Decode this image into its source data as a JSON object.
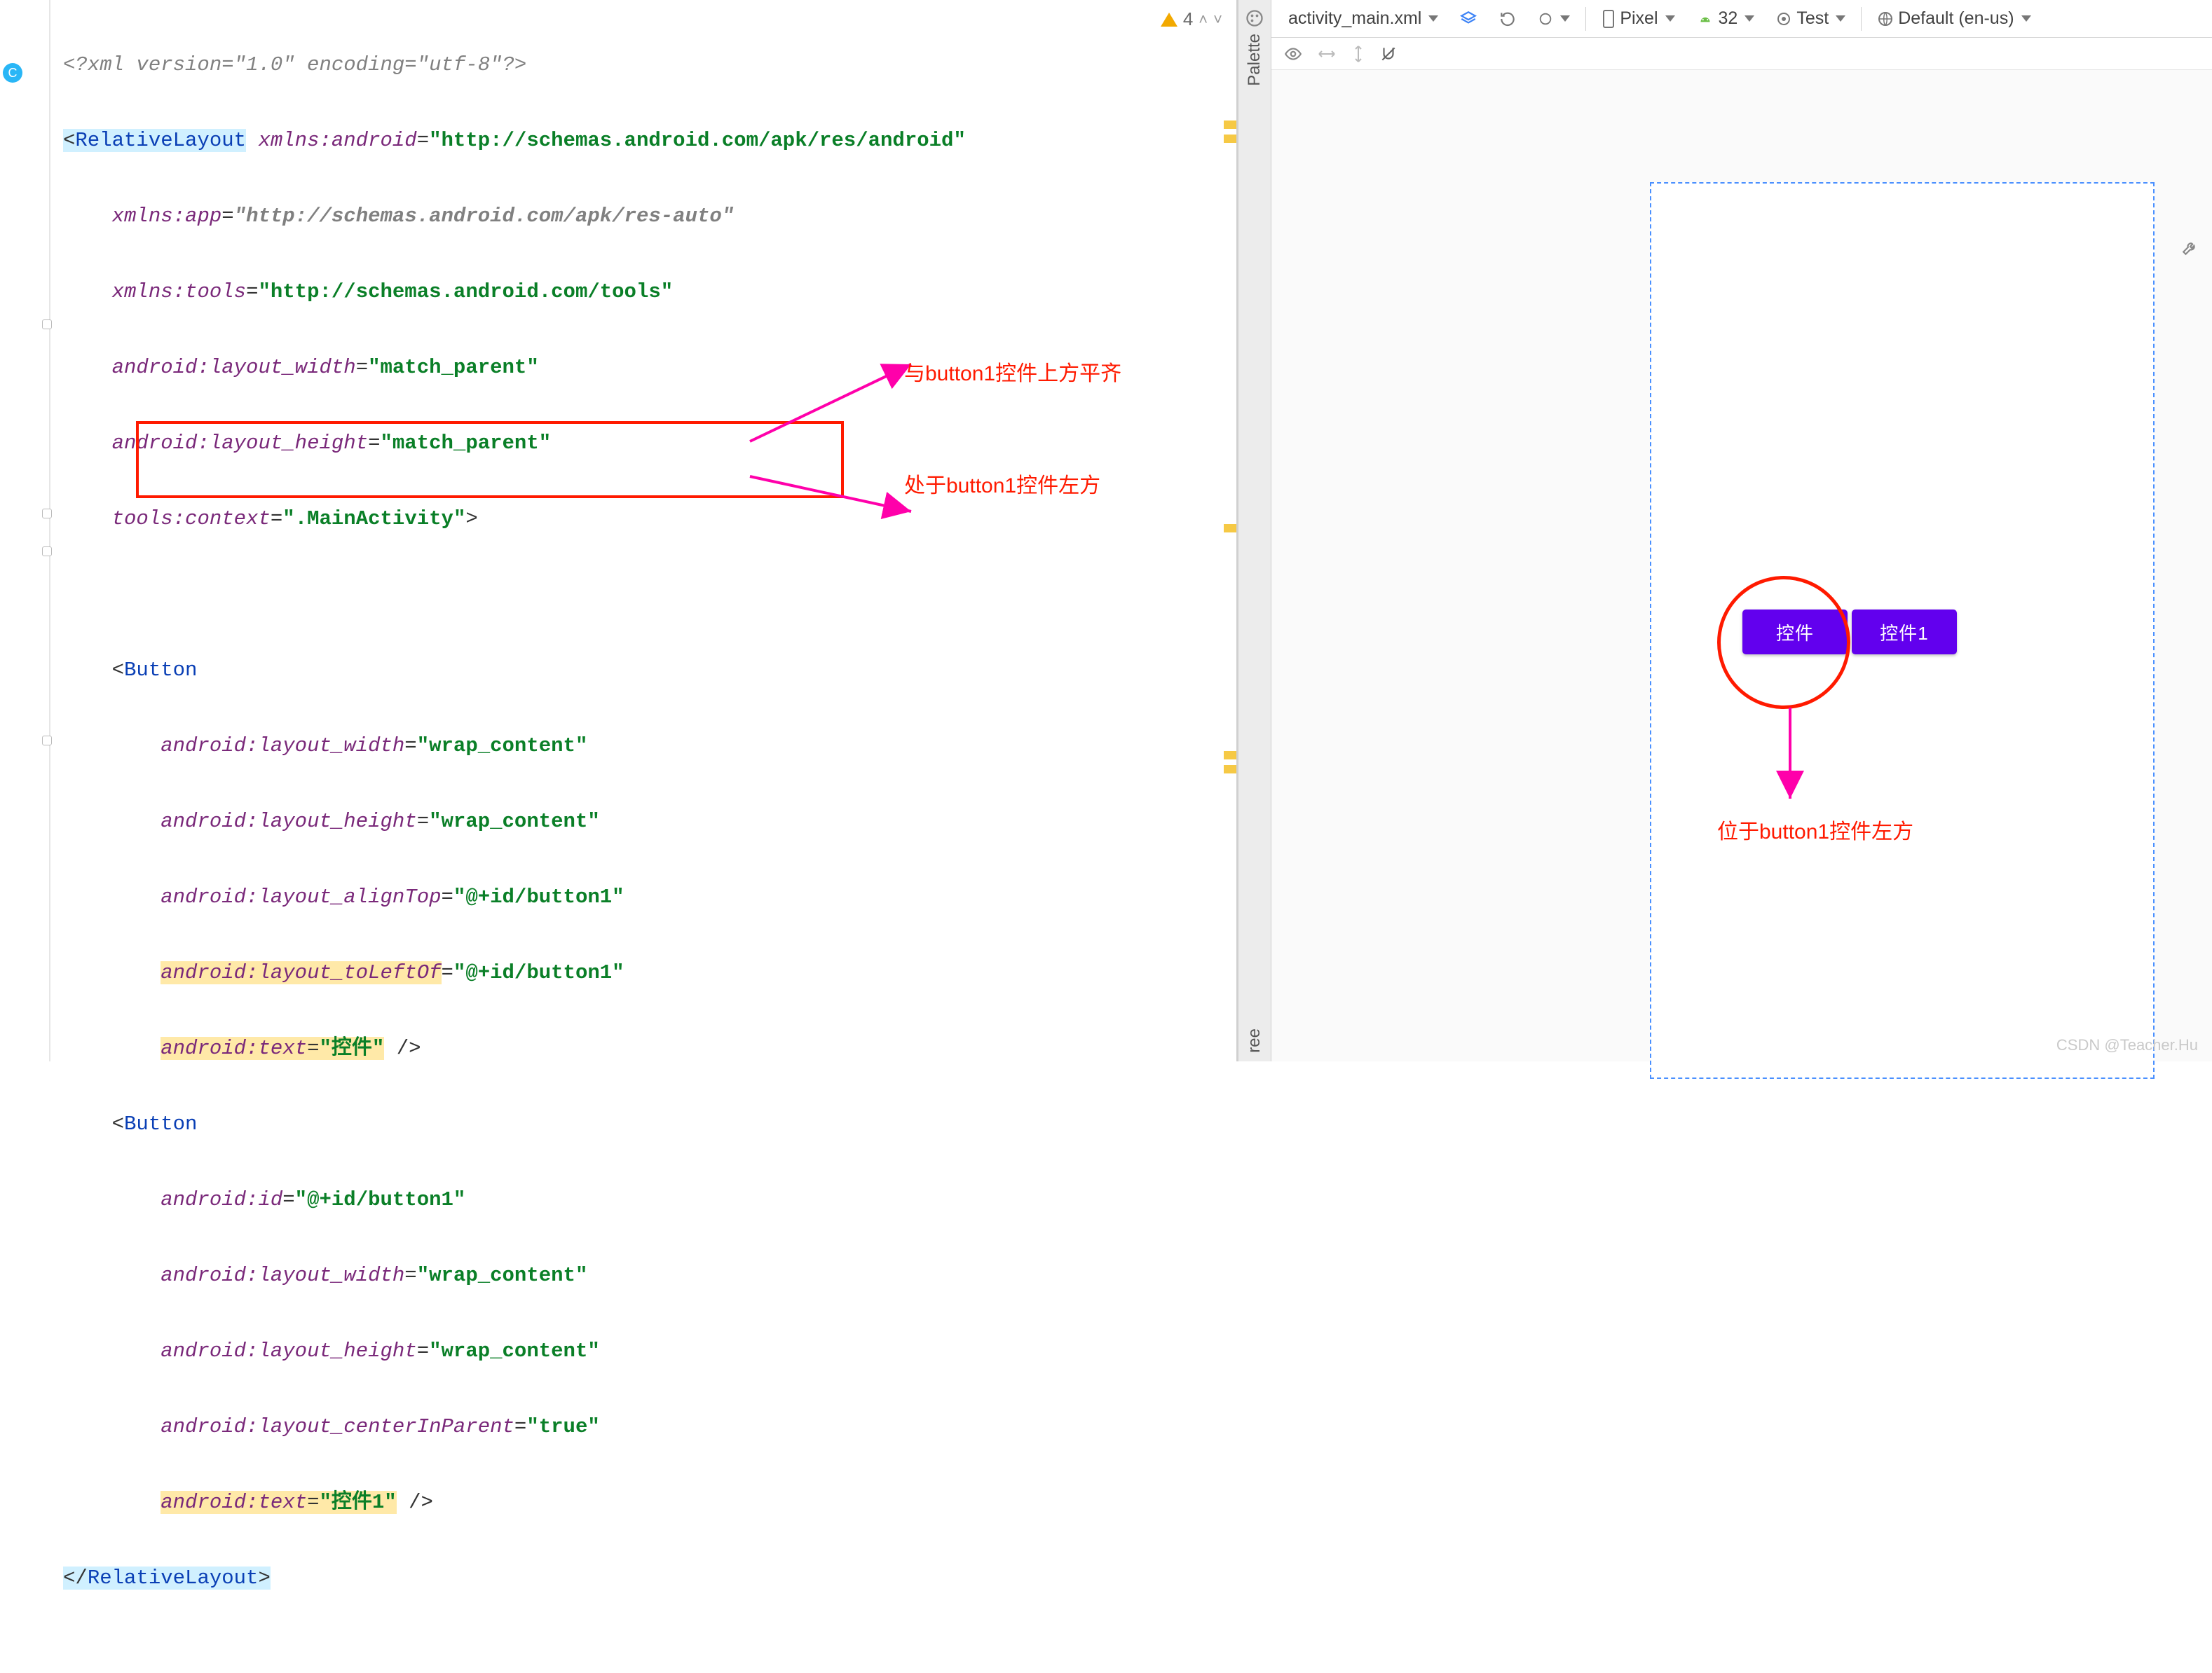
{
  "editor": {
    "gutter_circle": "C",
    "warning_count": "4",
    "lines": {
      "l1_xmldecl": "<?xml version=\"1.0\" encoding=\"utf-8\"?>",
      "l2_open_tag": "RelativeLayout",
      "l2_ns_attr": "xmlns:android",
      "l2_ns_val": "http://schemas.android.com/apk/res/android",
      "l3_attr": "xmlns:app",
      "l3_val": "http://schemas.android.com/apk/res-auto",
      "l4_attr": "xmlns:tools",
      "l4_val": "http://schemas.android.com/tools",
      "l5_attr": "android:layout_width",
      "l5_val": "match_parent",
      "l6_attr": "android:layout_height",
      "l6_val": "match_parent",
      "l7_attr": "tools:context",
      "l7_val": ".MainActivity",
      "l9_tag": "Button",
      "l10_attr": "android:layout_width",
      "l10_val": "wrap_content",
      "l11_attr": "android:layout_height",
      "l11_val": "wrap_content",
      "l12_attr": "android:layout_alignTop",
      "l12_val": "@+id/button1",
      "l13_attr": "android:layout_toLeftOf",
      "l13_val": "@+id/button1",
      "l14_attr": "android:text",
      "l14_val": "控件",
      "l15_tag": "Button",
      "l16_attr": "android:id",
      "l16_val": "@+id/button1",
      "l17_attr": "android:layout_width",
      "l17_val": "wrap_content",
      "l18_attr": "android:layout_height",
      "l18_val": "wrap_content",
      "l19_attr": "android:layout_centerInParent",
      "l19_val": "true",
      "l20_attr": "android:text",
      "l20_val": "控件1",
      "l21_close": "RelativeLayout"
    }
  },
  "annotations": {
    "align_top_note": "与button1控件上方平齐",
    "to_left_note": "处于button1控件左方",
    "preview_note": "位于button1控件左方"
  },
  "rails": {
    "palette": "Palette",
    "tree": "ree"
  },
  "toolbar": {
    "file": "activity_main.xml",
    "device": "Pixel",
    "api": "32",
    "theme": "Test",
    "locale": "Default (en-us)"
  },
  "preview": {
    "button_left": "控件",
    "button_center": "控件1"
  },
  "watermark": "CSDN @Teacher.Hu"
}
